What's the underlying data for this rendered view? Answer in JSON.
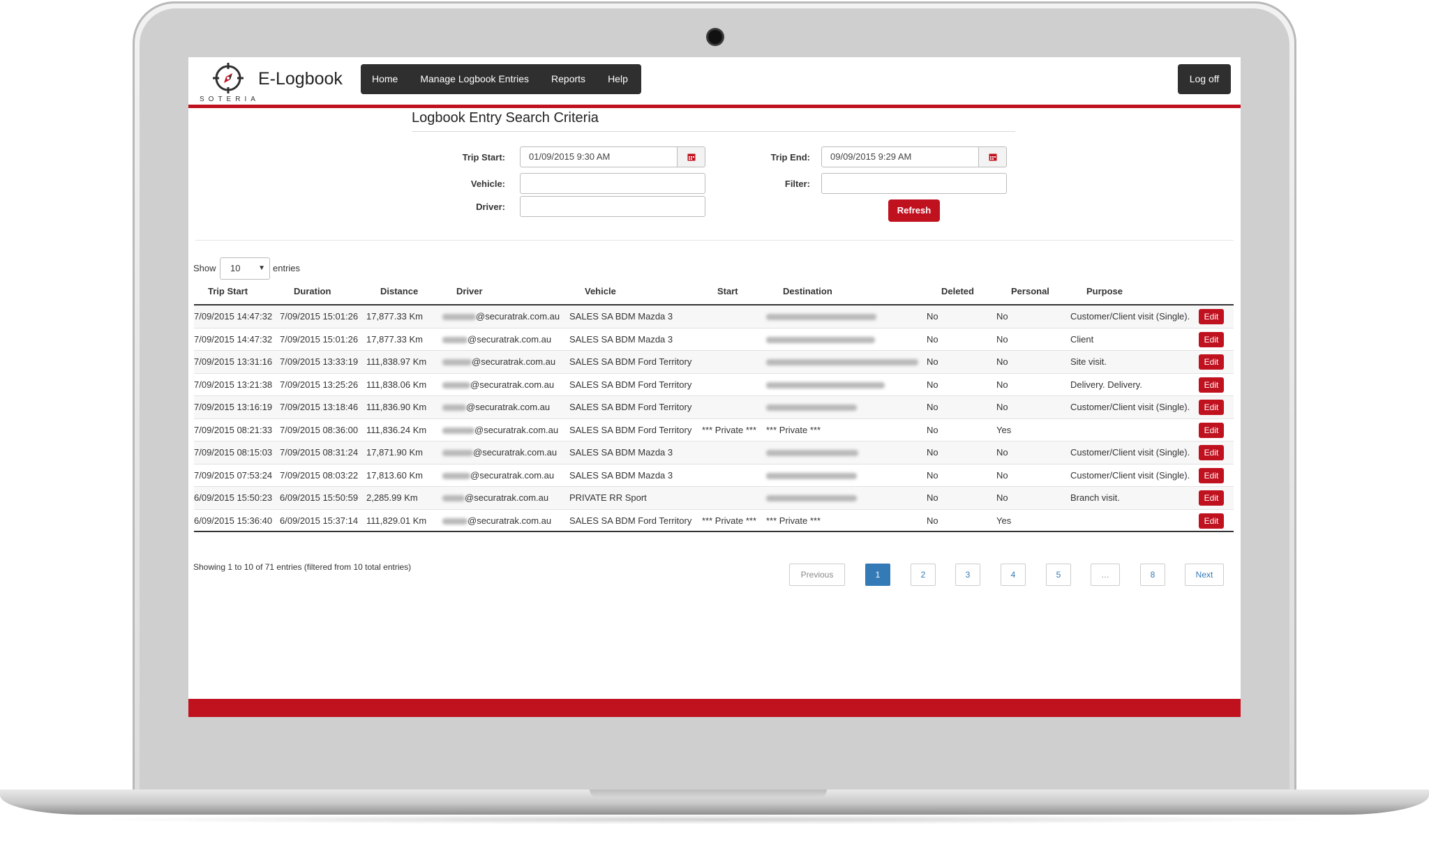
{
  "app": {
    "brand": "E-Logbook",
    "logo_text": "SOTERIA",
    "colors": {
      "accent": "#c0111f",
      "nav_dark": "#2f2f2f",
      "link": "#337ab7"
    }
  },
  "nav": {
    "items": [
      "Home",
      "Manage Logbook Entries",
      "Reports",
      "Help"
    ],
    "logoff": "Log off"
  },
  "criteria": {
    "title": "Logbook Entry Search Criteria",
    "trip_start_label": "Trip Start:",
    "trip_start_value": "01/09/2015 9:30 AM",
    "trip_end_label": "Trip End:",
    "trip_end_value": "09/09/2015 9:29 AM",
    "vehicle_label": "Vehicle:",
    "driver_label": "Driver:",
    "filter_label": "Filter:",
    "refresh": "Refresh"
  },
  "table_controls": {
    "show": "Show",
    "entries_value": "10",
    "entries": "entries"
  },
  "table": {
    "headers": [
      "Trip Start",
      "Duration",
      "Distance",
      "Driver",
      "Vehicle",
      "Start",
      "Destination",
      "Deleted",
      "Personal",
      "Purpose"
    ],
    "edit_label": "Edit",
    "rows": [
      {
        "trip_start": "7/09/2015 14:47:32",
        "duration": "7/09/2015 15:01:26",
        "distance": "17,877.33 Km",
        "driver": "@securatrak.com.au",
        "vehicle": "SALES SA BDM Mazda 3",
        "start": "",
        "destination": "",
        "deleted": "No",
        "personal": "No",
        "purpose": "Customer/Client visit (Single)."
      },
      {
        "trip_start": "7/09/2015 14:47:32",
        "duration": "7/09/2015 15:01:26",
        "distance": "17,877.33 Km",
        "driver": "@securatrak.com.au",
        "vehicle": "SALES SA BDM Mazda 3",
        "start": "",
        "destination": "",
        "deleted": "No",
        "personal": "No",
        "purpose": "Client"
      },
      {
        "trip_start": "7/09/2015 13:31:16",
        "duration": "7/09/2015 13:33:19",
        "distance": "111,838.97 Km",
        "driver": "@securatrak.com.au",
        "vehicle": "SALES SA BDM Ford Territory",
        "start": "",
        "destination": "",
        "deleted": "No",
        "personal": "No",
        "purpose": "Site visit."
      },
      {
        "trip_start": "7/09/2015 13:21:38",
        "duration": "7/09/2015 13:25:26",
        "distance": "111,838.06 Km",
        "driver": "@securatrak.com.au",
        "vehicle": "SALES SA BDM Ford Territory",
        "start": "",
        "destination": "",
        "deleted": "No",
        "personal": "No",
        "purpose": "Delivery. Delivery."
      },
      {
        "trip_start": "7/09/2015 13:16:19",
        "duration": "7/09/2015 13:18:46",
        "distance": "111,836.90 Km",
        "driver": "@securatrak.com.au",
        "vehicle": "SALES SA BDM Ford Territory",
        "start": "",
        "destination": "",
        "deleted": "No",
        "personal": "No",
        "purpose": "Customer/Client visit (Single)."
      },
      {
        "trip_start": "7/09/2015 08:21:33",
        "duration": "7/09/2015 08:36:00",
        "distance": "111,836.24 Km",
        "driver": "@securatrak.com.au",
        "vehicle": "SALES SA BDM Ford Territory",
        "start": "*** Private ***",
        "destination": "*** Private ***",
        "deleted": "No",
        "personal": "Yes",
        "purpose": ""
      },
      {
        "trip_start": "7/09/2015 08:15:03",
        "duration": "7/09/2015 08:31:24",
        "distance": "17,871.90 Km",
        "driver": "@securatrak.com.au",
        "vehicle": "SALES SA BDM Mazda 3",
        "start": "",
        "destination": "",
        "deleted": "No",
        "personal": "No",
        "purpose": "Customer/Client visit (Single)."
      },
      {
        "trip_start": "7/09/2015 07:53:24",
        "duration": "7/09/2015 08:03:22",
        "distance": "17,813.60 Km",
        "driver": "@securatrak.com.au",
        "vehicle": "SALES SA BDM Mazda 3",
        "start": "",
        "destination": "",
        "deleted": "No",
        "personal": "No",
        "purpose": "Customer/Client visit (Single)."
      },
      {
        "trip_start": "6/09/2015 15:50:23",
        "duration": "6/09/2015 15:50:59",
        "distance": "2,285.99 Km",
        "driver": "@securatrak.com.au",
        "vehicle": "PRIVATE RR Sport",
        "start": "",
        "destination": "",
        "deleted": "No",
        "personal": "No",
        "purpose": "Branch visit."
      },
      {
        "trip_start": "6/09/2015 15:36:40",
        "duration": "6/09/2015 15:37:14",
        "distance": "111,829.01 Km",
        "driver": "@securatrak.com.au",
        "vehicle": "SALES SA BDM Ford Territory",
        "start": "*** Private ***",
        "destination": "*** Private ***",
        "deleted": "No",
        "personal": "Yes",
        "purpose": ""
      }
    ]
  },
  "footer": {
    "info": "Showing 1 to 10 of 71 entries (filtered from 10 total entries)",
    "pagination": [
      "Previous",
      "1",
      "2",
      "3",
      "4",
      "5",
      "…",
      "8",
      "Next"
    ],
    "active_page": "1"
  }
}
